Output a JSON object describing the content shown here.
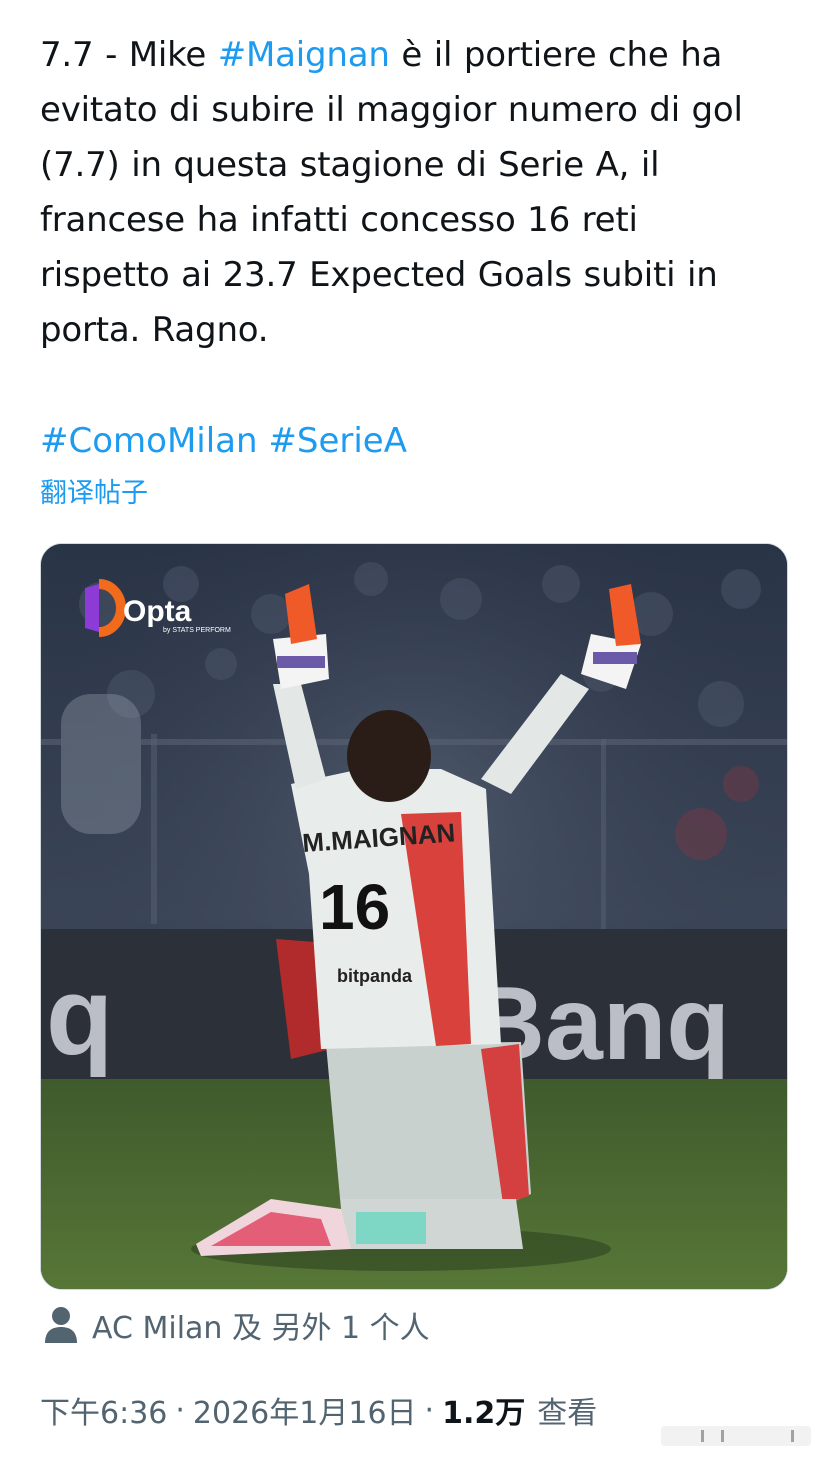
{
  "tweet": {
    "lines": [
      [
        "7.7 - Mike ",
        "#Maignan",
        " è il portiere che ha"
      ],
      [
        "evitato di subire il maggior numero di gol"
      ],
      [
        "(7.7) in questa stagione di Serie A, il"
      ],
      [
        "francese ha infatti concesso 16 reti"
      ],
      [
        "rispetto ai 23.7 Expected Goals subiti in"
      ],
      [
        "porta. Ragno."
      ]
    ],
    "hashtags": [
      "#ComoMilan",
      "#SerieA"
    ],
    "translate_label": "翻译帖子"
  },
  "media": {
    "logo_text": "Opta",
    "logo_subtext": "by STATS PERFORM",
    "jersey_name": "M.MAIGNAN",
    "jersey_number": "16",
    "sponsor": "bitpanda",
    "board_text": "q",
    "board_text_right": "iBanq"
  },
  "tagged": {
    "icon": "person-icon",
    "text": "AC Milan 及 另外 1 个人"
  },
  "meta": {
    "time": "下午6:36",
    "separator": "·",
    "date": "2026年1月16日",
    "views_count": "1.2万",
    "views_label": "查看"
  },
  "colors": {
    "link": "#1d9bf0",
    "secondary": "#536471",
    "text": "#0f1419"
  }
}
